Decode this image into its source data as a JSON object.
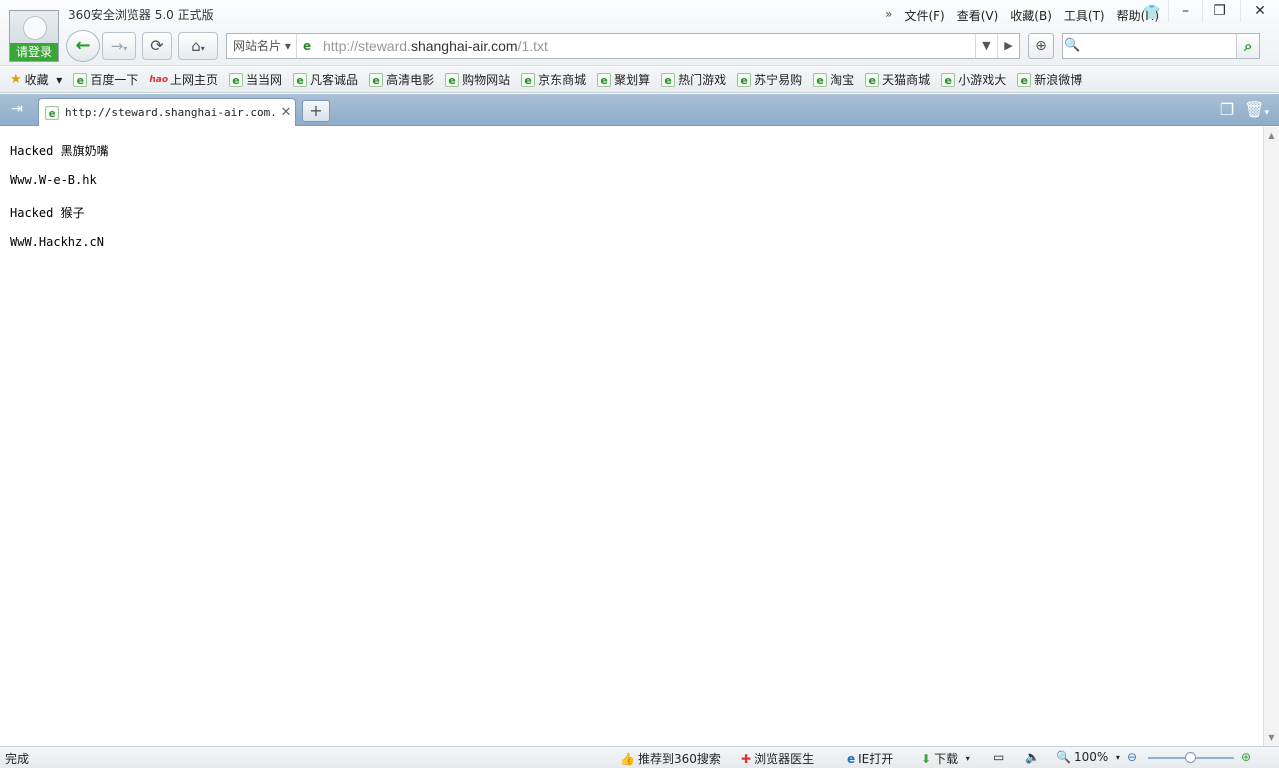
{
  "titlebar": {
    "login_label": "请登录",
    "app_title": "360安全浏览器 5.0 正式版",
    "menus": [
      "文件(F)",
      "查看(V)",
      "收藏(B)",
      "工具(T)",
      "帮助(H)"
    ],
    "minimize": "–",
    "restore": "❐",
    "close": "✕"
  },
  "navbar": {
    "site_card": "网站名片",
    "url_gray_prefix": "http://steward.",
    "url_domain": "shanghai-air.com",
    "url_gray_suffix": "/1.txt",
    "search_placeholder": ""
  },
  "bookmarks": {
    "favorites_label": "收藏",
    "items": [
      "百度一下",
      "上网主页",
      "当当网",
      "凡客诚品",
      "高清电影",
      "购物网站",
      "京东商城",
      "聚划算",
      "热门游戏",
      "苏宁易购",
      "淘宝",
      "天猫商城",
      "小游戏大",
      "新浪微博"
    ]
  },
  "tabs": [
    {
      "title": "http://steward.shanghai-air.com..."
    }
  ],
  "content": {
    "lines": [
      "Hacked 黑旗奶嘴",
      "Www.W-e-B.hk",
      "Hacked 猴子",
      "WwW.Hackhz.cN"
    ]
  },
  "statusbar": {
    "status": "完成",
    "recommend": "推荐到360搜索",
    "doctor": "浏览器医生",
    "ie_open": "IE打开",
    "download": "下载",
    "zoom": "100%"
  },
  "colors": {
    "accent_green": "#3aa637",
    "tabbar_blue": "#9db6ce"
  }
}
